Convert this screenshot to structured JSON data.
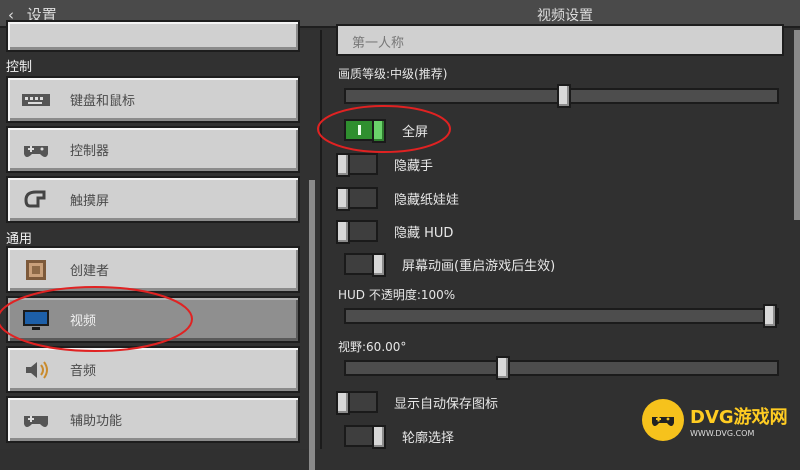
{
  "header": {
    "back_label": "设置",
    "title": "视频设置"
  },
  "sidebar": {
    "sections": [
      {
        "title": "控制"
      },
      {
        "title": "通用"
      }
    ],
    "items": [
      {
        "label": "键盘和鼠标",
        "icon": "keyboard-icon"
      },
      {
        "label": "控制器",
        "icon": "controller-icon"
      },
      {
        "label": "触摸屏",
        "icon": "touch-icon"
      },
      {
        "label": "创建者",
        "icon": "creator-icon"
      },
      {
        "label": "视频",
        "icon": "monitor-icon",
        "active": true
      },
      {
        "label": "音频",
        "icon": "speaker-icon"
      },
      {
        "label": "辅助功能",
        "icon": "accessibility-controller-icon"
      }
    ]
  },
  "settings": {
    "dropdown_value": "第一人称",
    "quality_label": "画质等级:中级(推荐)",
    "quality_value": 0.505,
    "fullscreen": {
      "label": "全屏",
      "on": true
    },
    "hide_hand": {
      "label": "隐藏手",
      "on": false
    },
    "hide_paperdoll": {
      "label": "隐藏纸娃娃",
      "on": false
    },
    "hide_hud": {
      "label": "隐藏 HUD",
      "on": false
    },
    "screen_anim": {
      "label": "屏幕动画(重启游戏后生效)",
      "on": true
    },
    "hud_opacity_label": "HUD 不透明度:100%",
    "hud_opacity_value": 1.0,
    "fov_label": "视野:60.00°",
    "fov_value": 0.36,
    "show_autosave": {
      "label": "显示自动保存图标",
      "on": false
    },
    "outline_select": {
      "label": "轮廓选择",
      "on": true
    }
  },
  "watermark": {
    "brand": "DVG游戏网",
    "url": "WWW.DVG.COM"
  },
  "colors": {
    "toggle_on": "#2f8f2f",
    "panel": "#303030",
    "button": "#d0d0d0"
  }
}
